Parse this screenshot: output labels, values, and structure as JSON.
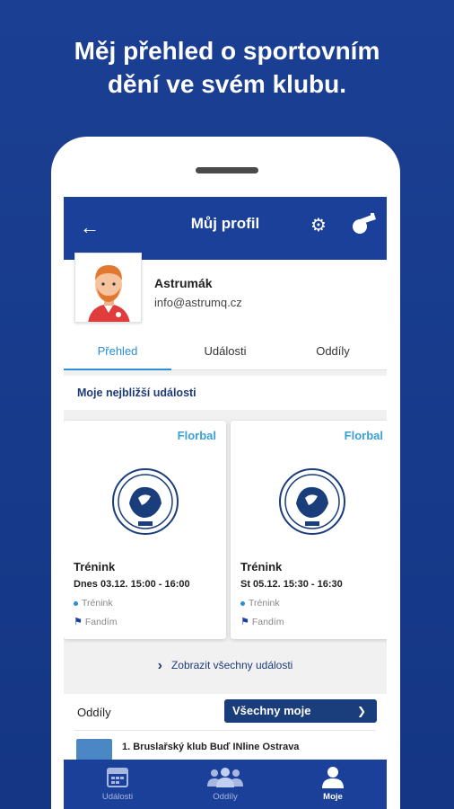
{
  "headline": {
    "line1": "Měj přehled o sportovním",
    "line2": "dění ve svém klubu."
  },
  "appbar": {
    "title": "Můj profil",
    "back_icon": "arrow-left-icon",
    "settings_icon": "gear-icon",
    "whistle_icon": "whistle-icon"
  },
  "profile": {
    "name": "Astrumák",
    "email": "info@astrumq.cz"
  },
  "tabs": [
    {
      "label": "Přehled",
      "active": true
    },
    {
      "label": "Události",
      "active": false
    },
    {
      "label": "Oddíly",
      "active": false
    }
  ],
  "events_section": {
    "title": "Moje nejbližší události",
    "cards": [
      {
        "sport": "Florbal",
        "title": "Trénink",
        "datetime": "Dnes 03.12. 15:00 - 16:00",
        "type": "Trénink",
        "role": "Fandím"
      },
      {
        "sport": "Florbal",
        "title": "Trénink",
        "datetime": "St 05.12. 15:30 - 16:30",
        "type": "Trénink",
        "role": "Fandím"
      }
    ],
    "show_all": "Zobrazit všechny události"
  },
  "groups": {
    "title": "Oddíly",
    "filter_value": "Všechny moje",
    "items": [
      {
        "name": "1. Bruslařský klub Buď INline Ostrava"
      }
    ]
  },
  "bottom_nav": [
    {
      "label": "Události",
      "icon": "calendar-icon",
      "active": false
    },
    {
      "label": "Oddíly",
      "icon": "people-icon",
      "active": false
    },
    {
      "label": "Moje",
      "icon": "person-icon",
      "active": true
    }
  ],
  "colors": {
    "background": "#1b3f93",
    "appbar": "#1a409a",
    "accent": "#2b8ed6",
    "sport_label": "#3aa0d8",
    "filter_button": "#1a3d7c"
  }
}
